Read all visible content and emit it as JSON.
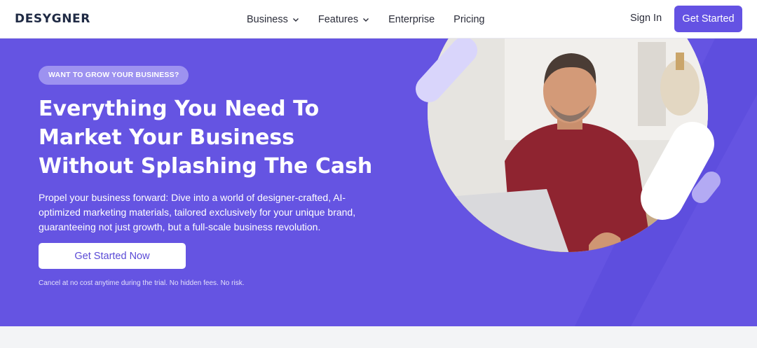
{
  "nav": {
    "logo": "DESYGNER",
    "menu": [
      {
        "label": "Business",
        "has_dropdown": true
      },
      {
        "label": "Features",
        "has_dropdown": true
      },
      {
        "label": "Enterprise",
        "has_dropdown": false
      },
      {
        "label": "Pricing",
        "has_dropdown": false
      }
    ],
    "sign_in": "Sign In",
    "get_started": "Get Started"
  },
  "hero": {
    "badge": "WANT TO GROW YOUR BUSINESS?",
    "headline": "Everything You Need To Market Your Business Without Splashing The Cash",
    "subtext": "Propel your business forward: Dive into a world of designer-crafted, AI-optimized marketing materials, tailored exclusively for your unique brand, guaranteeing not just growth, but a full-scale business revolution.",
    "cta": "Get Started Now",
    "note": "Cancel at no cost anytime during the trial. No hidden fees. No risk."
  },
  "colors": {
    "brand": "#6554e2",
    "button": "#6452e3",
    "badge": "#9d92f0",
    "text_dark": "#2b2d3a"
  },
  "icons": [
    "chevron-down-icon"
  ]
}
